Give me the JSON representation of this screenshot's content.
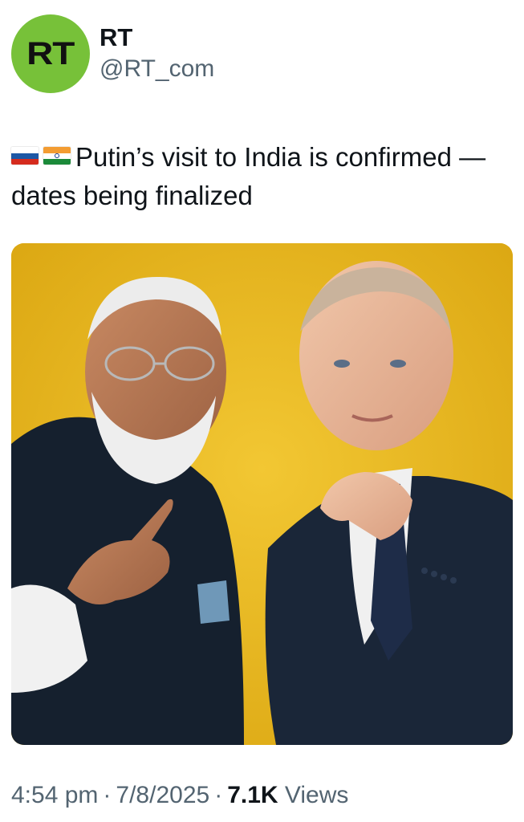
{
  "author": {
    "avatar_text": "RT",
    "display_name": "RT",
    "handle": "@RT_com"
  },
  "tweet": {
    "flags": [
      "russia-flag",
      "india-flag"
    ],
    "text": "Putin’s visit to India is confirmed — dates being finalized"
  },
  "footer": {
    "time": "4:54 pm",
    "date": "7/8/2025",
    "views_count": "7.1K",
    "views_label": "Views",
    "separator": "·"
  },
  "colors": {
    "avatar_bg": "#77c139",
    "photo_bg": "#e8b618",
    "secondary_text": "#536471"
  }
}
